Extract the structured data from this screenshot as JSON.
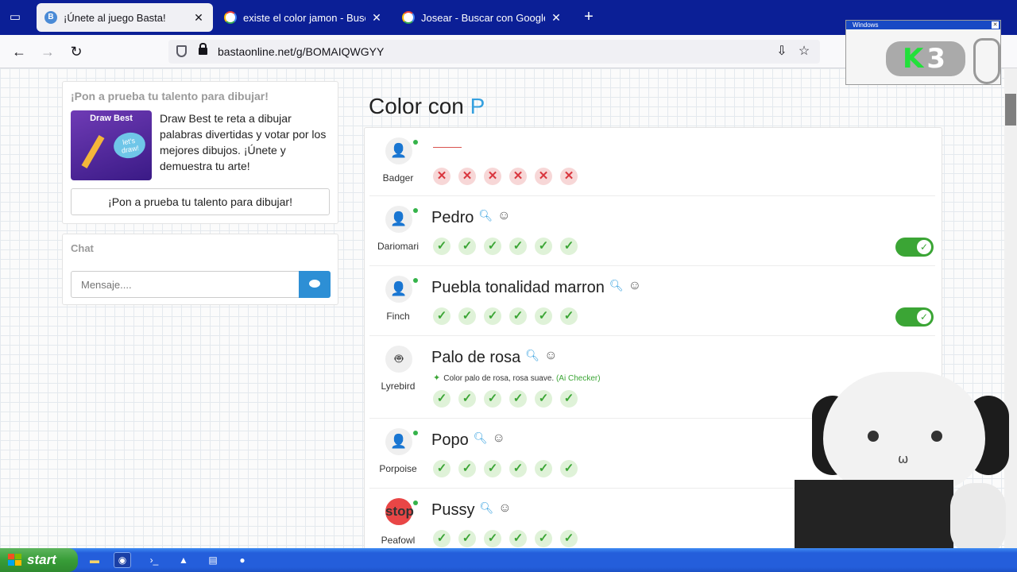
{
  "tabs": [
    {
      "title": "¡Únete al juego Basta!",
      "active": true,
      "favicon": "basta-icon"
    },
    {
      "title": "existe el color jamon - Buscar con Google",
      "active": false,
      "favicon": "google-icon"
    },
    {
      "title": "Josear - Buscar con Google",
      "active": false,
      "favicon": "google-icon"
    }
  ],
  "toolbar": {
    "url": "bastaonline.net/g/BOMAIQWGYY"
  },
  "sidebar": {
    "promo": {
      "heading": "¡Pon a prueba tu talento para dibujar!",
      "image_title": "Draw Best",
      "image_bubble": "let's draw!",
      "description": "Draw Best te reta a dibujar palabras divertidas y votar por los mejores dibujos. ¡Únete y demuestra tu arte!",
      "button_label": "¡Pon a prueba tu talento para dibujar!"
    },
    "chat": {
      "title": "Chat",
      "placeholder": "Mensaje...."
    }
  },
  "category": {
    "prefix": "Color con",
    "letter": "P"
  },
  "answers": [
    {
      "player": "Badger",
      "answer": "",
      "votes": [
        "no",
        "no",
        "no",
        "no",
        "no",
        "no"
      ],
      "toggle": false,
      "avatar": "user-icon"
    },
    {
      "player": "Dariomari",
      "answer": "Pedro",
      "votes": [
        "ok",
        "ok",
        "ok",
        "ok",
        "ok",
        "ok"
      ],
      "toggle": true,
      "avatar": "user-icon"
    },
    {
      "player": "Finch",
      "answer": "Puebla tonalidad marron",
      "votes": [
        "ok",
        "ok",
        "ok",
        "ok",
        "ok",
        "ok"
      ],
      "toggle": true,
      "avatar": "user-icon"
    },
    {
      "player": "Lyrebird",
      "answer": "Palo de rosa",
      "ai_note": "Color palo de rosa, rosa suave.",
      "ai_link": "(Ai Checker)",
      "votes": [
        "ok",
        "ok",
        "ok",
        "ok",
        "ok",
        "ok"
      ],
      "toggle": true,
      "avatar": "robot-icon"
    },
    {
      "player": "Porpoise",
      "answer": "Popo",
      "votes": [
        "ok",
        "ok",
        "ok",
        "ok",
        "ok",
        "ok"
      ],
      "toggle": true,
      "avatar": "user-star-icon"
    },
    {
      "player": "Peafowl",
      "answer": "Pussy",
      "votes": [
        "ok",
        "ok",
        "ok",
        "ok",
        "ok",
        "ok"
      ],
      "toggle": true,
      "avatar": "stop-sign-icon",
      "avatar_text": "stop"
    }
  ],
  "overlay": {
    "window_title": "Windows",
    "logo_k": "K",
    "logo_3": "3"
  },
  "taskbar": {
    "start_label": "start"
  },
  "colors": {
    "accent_blue": "#35a0df",
    "ok_green": "#3ba535",
    "no_red": "#d9363e",
    "tabbar": "#0b1f96"
  }
}
